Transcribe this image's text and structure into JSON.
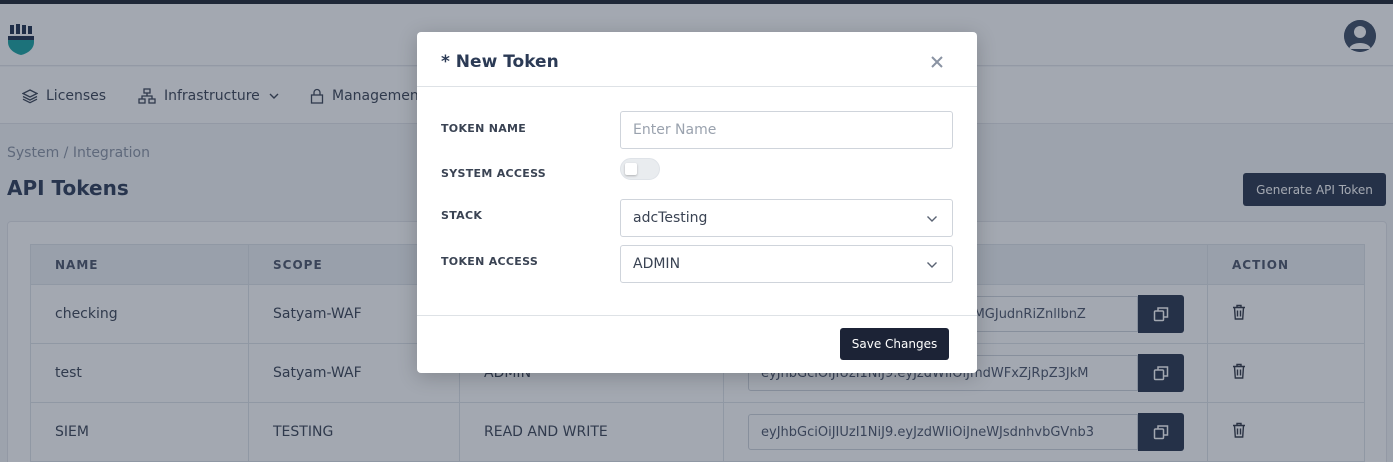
{
  "nav": {
    "items": [
      {
        "label": "Licenses"
      },
      {
        "label": "Infrastructure"
      },
      {
        "label": "Management"
      }
    ]
  },
  "breadcrumb": "System / Integration",
  "page": {
    "title": "API Tokens",
    "generate_button": "Generate API Token"
  },
  "table": {
    "headers": {
      "name": "NAME",
      "scope": "SCOPE",
      "access": "",
      "token": "",
      "action": "ACTION"
    },
    "rows": [
      {
        "name": "checking",
        "scope": "Satyam-WAF",
        "access": "",
        "token": "eyJhbGciOiJIUzI1NiJ9.eyJzdWIiOiJiMGJudnRiZnllbnZ"
      },
      {
        "name": "test",
        "scope": "Satyam-WAF",
        "access": "ADMIN",
        "token": "eyJhbGciOiJIUzI1NiJ9.eyJzdWIiOiJmdWFxZjRpZ3JkM"
      },
      {
        "name": "SIEM",
        "scope": "TESTING",
        "access": "READ AND WRITE",
        "token": "eyJhbGciOiJIUzI1NiJ9.eyJzdWIiOiJneWJsdnhvbGVnb3"
      }
    ]
  },
  "modal": {
    "title": "* New Token",
    "fields": {
      "token_name_label": "TOKEN NAME",
      "token_name_placeholder": "Enter Name",
      "system_access_label": "SYSTEM ACCESS",
      "system_access_on": false,
      "stack_label": "STACK",
      "stack_value": "adcTesting",
      "token_access_label": "TOKEN ACCESS",
      "token_access_value": "ADMIN"
    },
    "save_button": "Save Changes"
  },
  "colors": {
    "primary_dark": "#26324a",
    "logo_teal": "#17a2a0",
    "logo_dark": "#1c2e4a"
  },
  "icons": [
    "layers-icon",
    "network-icon",
    "lock-icon",
    "chevron-down-icon",
    "close-icon",
    "copy-icon",
    "trash-icon",
    "user-avatar-icon"
  ]
}
